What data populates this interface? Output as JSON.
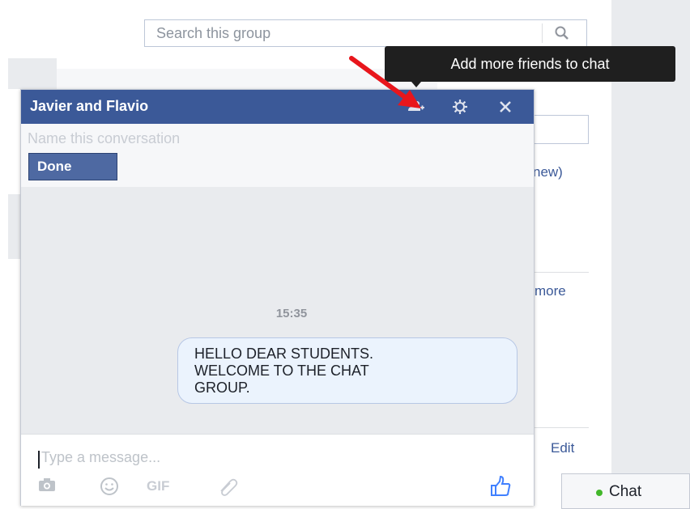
{
  "search": {
    "placeholder": "Search this group"
  },
  "tooltip": {
    "text": "Add more friends to chat"
  },
  "background": {
    "new_text": "new)",
    "more_text": "more",
    "edit_text": "Edit"
  },
  "chat_window": {
    "title": "Javier and Flavio",
    "name_placeholder": "Name this conversation",
    "done_label": "Done",
    "timestamp": "15:35",
    "message_lines": [
      "HELLO DEAR STUDENTS.",
      "WELCOME TO THE CHAT",
      "GROUP."
    ],
    "composer_placeholder": "Type a message...",
    "gif_label": "GIF"
  },
  "chat_tab": {
    "label": "Chat"
  },
  "colors": {
    "header_blue": "#3b5998",
    "online_green": "#42b72a",
    "annotation_red": "#e8161c"
  }
}
